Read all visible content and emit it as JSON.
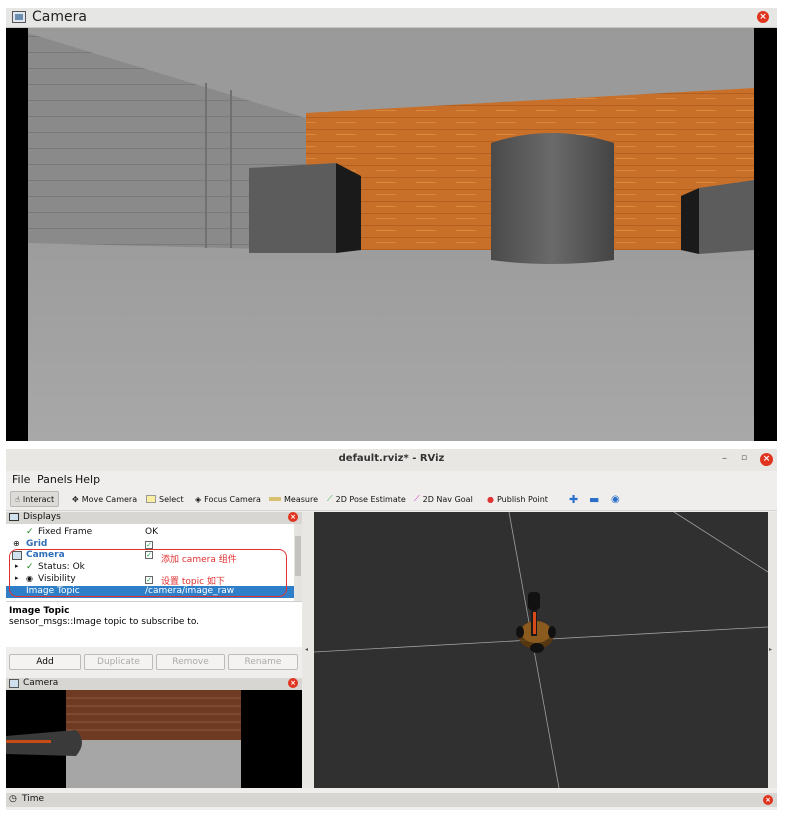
{
  "camera_window": {
    "title": "Camera"
  },
  "rviz": {
    "window_title": "default.rviz* - RViz",
    "menu": [
      "File",
      "Panels",
      "Help"
    ],
    "toolbar": [
      "Interact",
      "Move Camera",
      "Select",
      "Focus Camera",
      "Measure",
      "2D Pose Estimate",
      "2D Nav Goal",
      "Publish Point"
    ],
    "displays": {
      "title": "Displays",
      "fixed_frame_label": "Fixed Frame",
      "fixed_frame_value": "OK",
      "grid_label": "Grid",
      "camera_label": "Camera",
      "status_label": "Status: Ok",
      "visibility_label": "Visibility",
      "image_topic_label": "Image Topic",
      "image_topic_value": "/camera/image_raw",
      "annotation_1": "添加 camera 组件",
      "annotation_2": "设置 topic 如下"
    },
    "description": {
      "title": "Image Topic",
      "text": "sensor_msgs::Image topic to subscribe to."
    },
    "buttons": {
      "add": "Add",
      "duplicate": "Duplicate",
      "remove": "Remove",
      "rename": "Rename"
    },
    "camera_panel": {
      "title": "Camera"
    },
    "time_panel": {
      "title": "Time"
    },
    "colors": {
      "selection": "#2f7fc8",
      "annotation": "#e03030",
      "viewport_bg": "#303030"
    }
  }
}
